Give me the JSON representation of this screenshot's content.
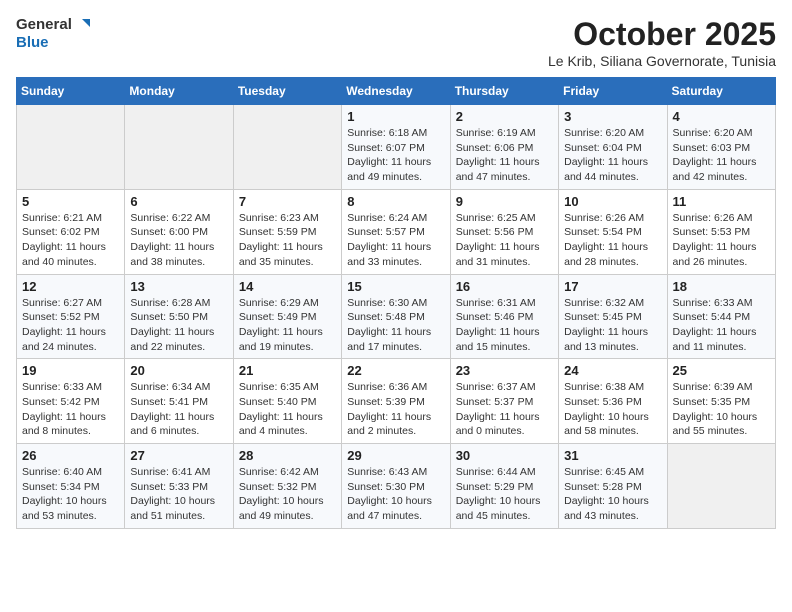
{
  "header": {
    "logo_general": "General",
    "logo_blue": "Blue",
    "title": "October 2025",
    "subtitle": "Le Krib, Siliana Governorate, Tunisia"
  },
  "calendar": {
    "columns": [
      "Sunday",
      "Monday",
      "Tuesday",
      "Wednesday",
      "Thursday",
      "Friday",
      "Saturday"
    ],
    "weeks": [
      [
        {
          "day": "",
          "info": ""
        },
        {
          "day": "",
          "info": ""
        },
        {
          "day": "",
          "info": ""
        },
        {
          "day": "1",
          "info": "Sunrise: 6:18 AM\nSunset: 6:07 PM\nDaylight: 11 hours and 49 minutes."
        },
        {
          "day": "2",
          "info": "Sunrise: 6:19 AM\nSunset: 6:06 PM\nDaylight: 11 hours and 47 minutes."
        },
        {
          "day": "3",
          "info": "Sunrise: 6:20 AM\nSunset: 6:04 PM\nDaylight: 11 hours and 44 minutes."
        },
        {
          "day": "4",
          "info": "Sunrise: 6:20 AM\nSunset: 6:03 PM\nDaylight: 11 hours and 42 minutes."
        }
      ],
      [
        {
          "day": "5",
          "info": "Sunrise: 6:21 AM\nSunset: 6:02 PM\nDaylight: 11 hours and 40 minutes."
        },
        {
          "day": "6",
          "info": "Sunrise: 6:22 AM\nSunset: 6:00 PM\nDaylight: 11 hours and 38 minutes."
        },
        {
          "day": "7",
          "info": "Sunrise: 6:23 AM\nSunset: 5:59 PM\nDaylight: 11 hours and 35 minutes."
        },
        {
          "day": "8",
          "info": "Sunrise: 6:24 AM\nSunset: 5:57 PM\nDaylight: 11 hours and 33 minutes."
        },
        {
          "day": "9",
          "info": "Sunrise: 6:25 AM\nSunset: 5:56 PM\nDaylight: 11 hours and 31 minutes."
        },
        {
          "day": "10",
          "info": "Sunrise: 6:26 AM\nSunset: 5:54 PM\nDaylight: 11 hours and 28 minutes."
        },
        {
          "day": "11",
          "info": "Sunrise: 6:26 AM\nSunset: 5:53 PM\nDaylight: 11 hours and 26 minutes."
        }
      ],
      [
        {
          "day": "12",
          "info": "Sunrise: 6:27 AM\nSunset: 5:52 PM\nDaylight: 11 hours and 24 minutes."
        },
        {
          "day": "13",
          "info": "Sunrise: 6:28 AM\nSunset: 5:50 PM\nDaylight: 11 hours and 22 minutes."
        },
        {
          "day": "14",
          "info": "Sunrise: 6:29 AM\nSunset: 5:49 PM\nDaylight: 11 hours and 19 minutes."
        },
        {
          "day": "15",
          "info": "Sunrise: 6:30 AM\nSunset: 5:48 PM\nDaylight: 11 hours and 17 minutes."
        },
        {
          "day": "16",
          "info": "Sunrise: 6:31 AM\nSunset: 5:46 PM\nDaylight: 11 hours and 15 minutes."
        },
        {
          "day": "17",
          "info": "Sunrise: 6:32 AM\nSunset: 5:45 PM\nDaylight: 11 hours and 13 minutes."
        },
        {
          "day": "18",
          "info": "Sunrise: 6:33 AM\nSunset: 5:44 PM\nDaylight: 11 hours and 11 minutes."
        }
      ],
      [
        {
          "day": "19",
          "info": "Sunrise: 6:33 AM\nSunset: 5:42 PM\nDaylight: 11 hours and 8 minutes."
        },
        {
          "day": "20",
          "info": "Sunrise: 6:34 AM\nSunset: 5:41 PM\nDaylight: 11 hours and 6 minutes."
        },
        {
          "day": "21",
          "info": "Sunrise: 6:35 AM\nSunset: 5:40 PM\nDaylight: 11 hours and 4 minutes."
        },
        {
          "day": "22",
          "info": "Sunrise: 6:36 AM\nSunset: 5:39 PM\nDaylight: 11 hours and 2 minutes."
        },
        {
          "day": "23",
          "info": "Sunrise: 6:37 AM\nSunset: 5:37 PM\nDaylight: 11 hours and 0 minutes."
        },
        {
          "day": "24",
          "info": "Sunrise: 6:38 AM\nSunset: 5:36 PM\nDaylight: 10 hours and 58 minutes."
        },
        {
          "day": "25",
          "info": "Sunrise: 6:39 AM\nSunset: 5:35 PM\nDaylight: 10 hours and 55 minutes."
        }
      ],
      [
        {
          "day": "26",
          "info": "Sunrise: 6:40 AM\nSunset: 5:34 PM\nDaylight: 10 hours and 53 minutes."
        },
        {
          "day": "27",
          "info": "Sunrise: 6:41 AM\nSunset: 5:33 PM\nDaylight: 10 hours and 51 minutes."
        },
        {
          "day": "28",
          "info": "Sunrise: 6:42 AM\nSunset: 5:32 PM\nDaylight: 10 hours and 49 minutes."
        },
        {
          "day": "29",
          "info": "Sunrise: 6:43 AM\nSunset: 5:30 PM\nDaylight: 10 hours and 47 minutes."
        },
        {
          "day": "30",
          "info": "Sunrise: 6:44 AM\nSunset: 5:29 PM\nDaylight: 10 hours and 45 minutes."
        },
        {
          "day": "31",
          "info": "Sunrise: 6:45 AM\nSunset: 5:28 PM\nDaylight: 10 hours and 43 minutes."
        },
        {
          "day": "",
          "info": ""
        }
      ]
    ]
  }
}
